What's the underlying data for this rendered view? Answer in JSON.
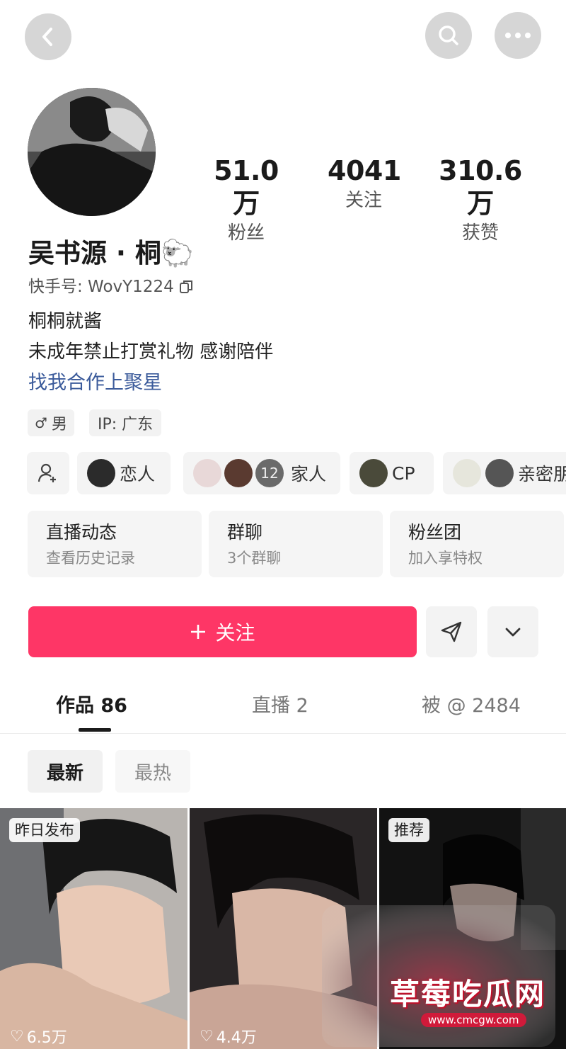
{
  "header": {
    "back_icon": "chevron-left-icon",
    "search_icon": "search-icon",
    "more_icon": "more-dots-icon"
  },
  "profile": {
    "name": "吴书源 · 桐🐑",
    "id_label": "快手号: WovY1224",
    "bio_line1": "桐桐就酱",
    "bio_line2": "未成年禁止打赏礼物 感谢陪伴",
    "link_text": "找我合作上聚星",
    "gender_tag": "男",
    "ip_tag": "IP: 广东"
  },
  "stats": [
    {
      "value": "51.0万",
      "label": "粉丝"
    },
    {
      "value": "4041",
      "label": "关注"
    },
    {
      "value": "310.6万",
      "label": "获赞"
    }
  ],
  "relations": {
    "lover": "恋人",
    "family_count": "12",
    "family": "家人",
    "cp": "CP",
    "close": "亲密朋"
  },
  "cards": [
    {
      "title": "直播动态",
      "sub": "查看历史记录"
    },
    {
      "title": "群聊",
      "sub": "3个群聊"
    },
    {
      "title": "粉丝团",
      "sub": "加入享特权"
    }
  ],
  "actions": {
    "follow_label": "关注",
    "follow_icon": "plus-icon",
    "share_icon": "send-icon",
    "expand_icon": "chevron-down-icon"
  },
  "tabs": [
    {
      "label": "作品 86"
    },
    {
      "label": "直播 2"
    },
    {
      "label": "被 @ 2484"
    }
  ],
  "filters": [
    {
      "label": "最新"
    },
    {
      "label": "最热"
    }
  ],
  "videos": [
    {
      "badge": "昨日发布",
      "likes": "6.5万"
    },
    {
      "badge": "",
      "likes": "4.4万"
    },
    {
      "badge": "推荐",
      "likes": ""
    }
  ],
  "watermark": {
    "title": "草莓吃瓜网",
    "url": "www.cmcgw.com"
  }
}
